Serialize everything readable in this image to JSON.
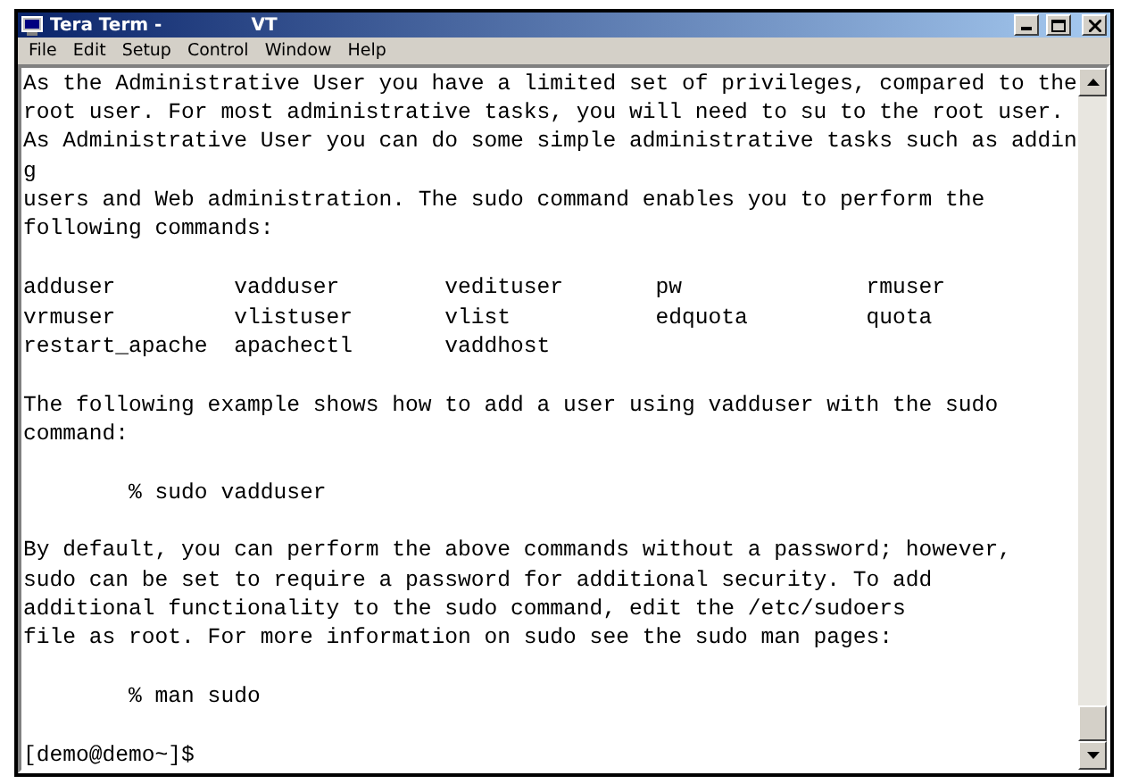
{
  "window": {
    "title": "Tera Term -",
    "subtitle": "VT"
  },
  "menu": [
    "File",
    "Edit",
    "Setup",
    "Control",
    "Window",
    "Help"
  ],
  "terminal": {
    "lines": [
      {
        "kind": "text",
        "text": "As the Administrative User you have a limited set of privileges, compared to the"
      },
      {
        "kind": "text",
        "text": "root user. For most administrative tasks, you will need to su to the root user."
      },
      {
        "kind": "text",
        "text": "As Administrative User you can do some simple administrative tasks such as addin"
      },
      {
        "kind": "text",
        "text": "g"
      },
      {
        "kind": "text",
        "text": "users and Web administration. The sudo command enables you to perform the"
      },
      {
        "kind": "text",
        "text": "following commands:"
      },
      {
        "kind": "blank"
      },
      {
        "kind": "columns",
        "cells": [
          "adduser",
          "vadduser",
          "vedituser",
          "pw",
          "rmuser"
        ]
      },
      {
        "kind": "columns",
        "cells": [
          "vrmuser",
          "vlistuser",
          "vlist",
          "edquota",
          "quota"
        ]
      },
      {
        "kind": "columns",
        "cells": [
          "restart_apache",
          "apachectl",
          "vaddhost"
        ]
      },
      {
        "kind": "blank"
      },
      {
        "kind": "text",
        "text": "The following example shows how to add a user using vadduser with the sudo"
      },
      {
        "kind": "text",
        "text": "command:"
      },
      {
        "kind": "blank"
      },
      {
        "kind": "text",
        "text": "        % sudo vadduser"
      },
      {
        "kind": "blank"
      },
      {
        "kind": "text",
        "text": "By default, you can perform the above commands without a password; however,"
      },
      {
        "kind": "text",
        "text": "sudo can be set to require a password for additional security. To add"
      },
      {
        "kind": "text",
        "text": "additional functionality to the sudo command, edit the /etc/sudoers"
      },
      {
        "kind": "text",
        "text": "file as root. For more information on sudo see the sudo man pages:"
      },
      {
        "kind": "blank"
      },
      {
        "kind": "text",
        "text": "        % man sudo"
      },
      {
        "kind": "blank"
      },
      {
        "kind": "text",
        "text": "[demo@demo~]$"
      }
    ]
  }
}
